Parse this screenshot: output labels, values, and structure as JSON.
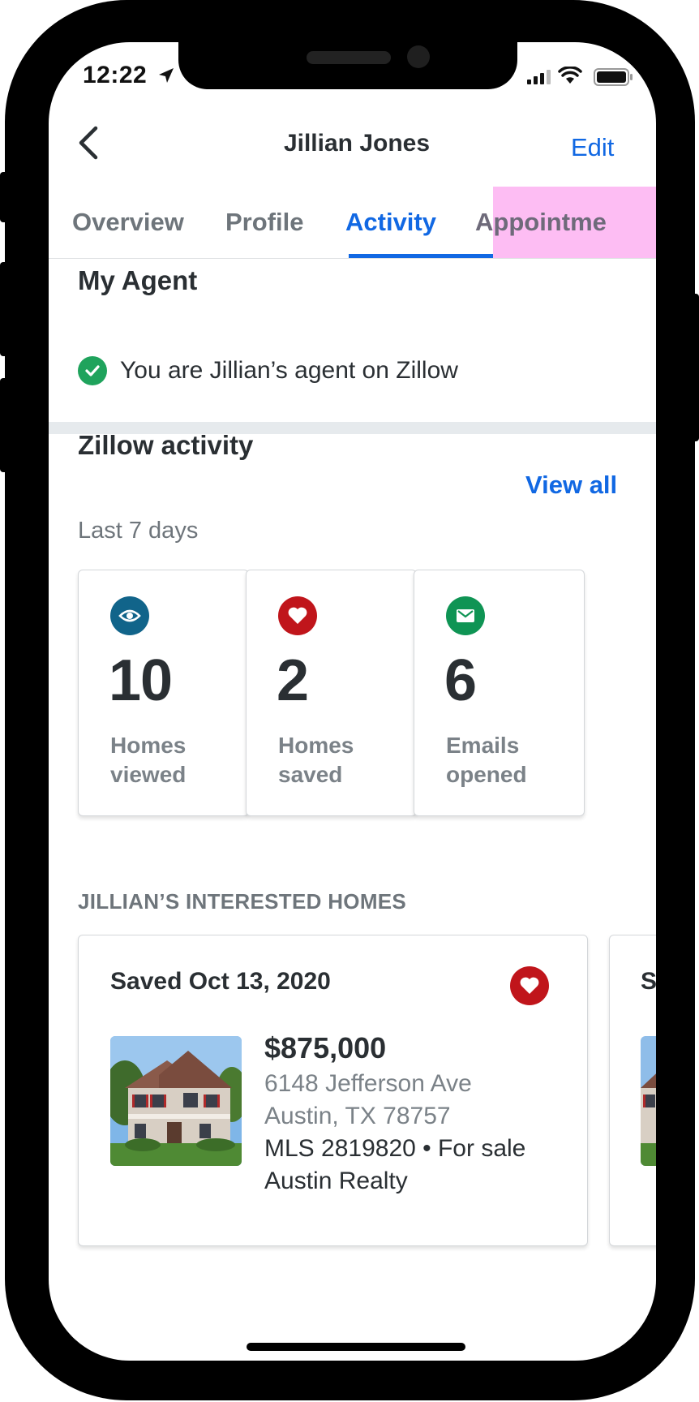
{
  "status_bar": {
    "time": "12:22"
  },
  "header": {
    "title": "Jillian Jones",
    "edit_label": "Edit"
  },
  "tabs": [
    {
      "label": "Overview"
    },
    {
      "label": "Profile"
    },
    {
      "label": "Activity"
    },
    {
      "label": "Appointme"
    }
  ],
  "active_tab": "Activity",
  "agent": {
    "title": "My Agent",
    "status_text": "You are Jillian’s agent on Zillow"
  },
  "activity": {
    "title": "Zillow activity",
    "view_all_label": "View all",
    "period": "Last 7 days",
    "stats": [
      {
        "icon": "eye-icon",
        "value": "10",
        "label_line1": "Homes",
        "label_line2": "viewed",
        "color": "#11648a"
      },
      {
        "icon": "heart-icon",
        "value": "2",
        "label_line1": "Homes",
        "label_line2": "saved",
        "color": "#c0151b"
      },
      {
        "icon": "envelope-icon",
        "value": "6",
        "label_line1": "Emails",
        "label_line2": "opened",
        "color": "#0f9454"
      }
    ]
  },
  "interested_homes": {
    "heading": "JILLIAN’S INTERESTED HOMES",
    "homes": [
      {
        "saved_label": "Saved Oct 13, 2020",
        "price": "$875,000",
        "street": "6148 Jefferson Ave",
        "city": "Austin, TX 78757",
        "mls_status": "MLS 2819820 • For sale",
        "brokerage": "Austin Realty"
      }
    ],
    "next_card_partial": "S"
  },
  "colors": {
    "accent": "#1168e3",
    "text": "#2a2f33",
    "muted": "#6e757b",
    "success": "#1fa35c",
    "heart": "#c0151b",
    "tab_highlight": "#fdbdf3"
  }
}
